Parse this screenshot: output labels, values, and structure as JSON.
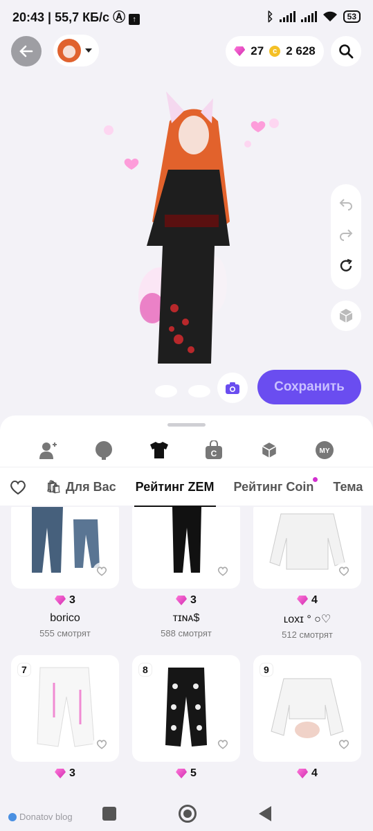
{
  "status": {
    "time": "20:43",
    "speed": "55,7 КБ/с",
    "battery": "53"
  },
  "header": {
    "gems": "27",
    "coins": "2 628"
  },
  "actions": {
    "save_label": "Сохранить"
  },
  "tabs": [
    {
      "label": "Для Вас"
    },
    {
      "label": "Рейтинг ZEM"
    },
    {
      "label": "Рейтинг Coin"
    },
    {
      "label": "Тема"
    }
  ],
  "categories": [
    "avatar-add",
    "head",
    "clothes",
    "coin-shop",
    "3d",
    "my"
  ],
  "items": [
    {
      "price": "3",
      "author": "borico",
      "views": "555 смотрят"
    },
    {
      "price": "3",
      "author": "ᴛɪɴᴀ$",
      "views": "588 смотрят"
    },
    {
      "price": "4",
      "author": "ʟᴏxɪ ° ○♡",
      "views": "512 смотрят"
    },
    {
      "rank": "7",
      "price": "3"
    },
    {
      "rank": "8",
      "price": "5"
    },
    {
      "rank": "9",
      "price": "4"
    }
  ],
  "watermark": "Donatov blog",
  "colors": {
    "accent": "#6a4df0",
    "gem": "#d12ab0",
    "coin": "#f4c026"
  }
}
